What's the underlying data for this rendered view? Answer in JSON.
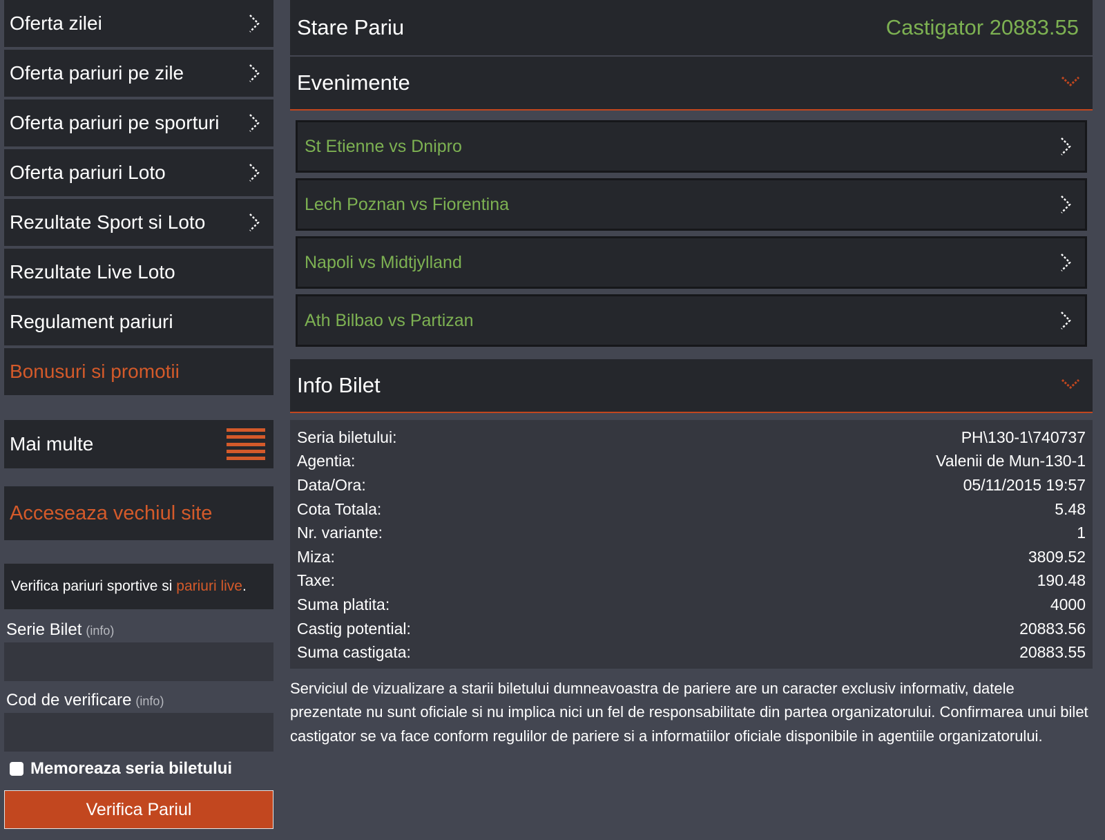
{
  "sidebar": {
    "nav": [
      {
        "label": "Oferta zilei",
        "chevron": true,
        "accent": false
      },
      {
        "label": "Oferta pariuri pe zile",
        "chevron": true,
        "accent": false
      },
      {
        "label": "Oferta pariuri pe sporturi",
        "chevron": true,
        "accent": false
      },
      {
        "label": "Oferta pariuri Loto",
        "chevron": true,
        "accent": false
      },
      {
        "label": "Rezultate Sport si Loto",
        "chevron": true,
        "accent": false
      },
      {
        "label": "Rezultate Live Loto",
        "chevron": false,
        "accent": false
      },
      {
        "label": "Regulament pariuri",
        "chevron": false,
        "accent": false
      },
      {
        "label": "Bonusuri si promotii",
        "chevron": false,
        "accent": true
      }
    ],
    "more_label": "Mai multe",
    "old_site_label": "Acceseaza vechiul site",
    "verify": {
      "intro_text": "Verifica pariuri sportive si ",
      "intro_link": "pariuri live",
      "intro_end": ".",
      "serie_label": "Serie Bilet",
      "serie_info": "(info)",
      "serie_value": "",
      "code_label": "Cod de verificare",
      "code_info": "(info)",
      "code_value": "",
      "remember_label": "Memoreaza seria biletului",
      "button_label": "Verifica Pariul"
    }
  },
  "main": {
    "status_title": "Stare Pariu",
    "status_value": "Castigator 20883.55",
    "events_title": "Evenimente",
    "events": [
      {
        "label": "St Etienne vs Dnipro"
      },
      {
        "label": "Lech Poznan vs Fiorentina"
      },
      {
        "label": "Napoli vs Midtjylland"
      },
      {
        "label": "Ath Bilbao vs Partizan"
      }
    ],
    "info_title": "Info Bilet",
    "info_rows": [
      {
        "key": "Seria biletului:",
        "value": "PH\\130-1\\740737"
      },
      {
        "key": "Agentia:",
        "value": "Valenii de Mun-130-1"
      },
      {
        "key": "Data/Ora:",
        "value": "05/11/2015 19:57"
      },
      {
        "key": "Cota Totala:",
        "value": "5.48"
      },
      {
        "key": "Nr. variante:",
        "value": "1"
      },
      {
        "key": "Miza:",
        "value": "3809.52"
      },
      {
        "key": "Taxe:",
        "value": "190.48"
      },
      {
        "key": "Suma platita:",
        "value": "4000"
      },
      {
        "key": "Castig potential:",
        "value": "20883.56"
      },
      {
        "key": "Suma castigata:",
        "value": "20883.55"
      }
    ],
    "disclaimer": "Serviciul de vizualizare a starii biletului dumneavoastra de pariere are un caracter exclusiv informativ, datele prezentate nu sunt oficiale si nu implica nici un fel de responsabilitate din partea organizatorului. Confirmarea unui bilet castigator se va face conform regulilor de pariere si a informatiilor oficiale disponibile in agentiile organizatorului."
  },
  "colors": {
    "background": "#434651",
    "panel": "#25272c",
    "accent": "#d45a2a",
    "success": "#7db152",
    "button": "#c2471f"
  },
  "icons": {
    "nav_chevron": "chevron-right-icon",
    "section_toggle": "chevron-down-icon",
    "menu": "hamburger-menu-icon"
  }
}
